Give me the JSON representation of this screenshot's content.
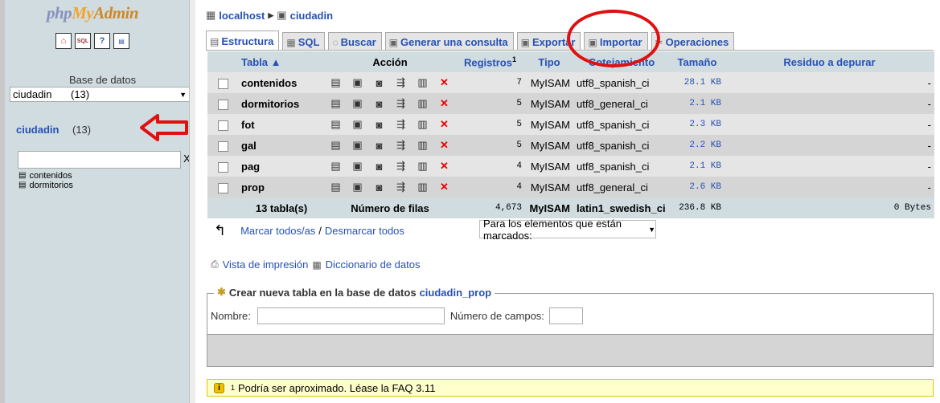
{
  "left": {
    "logo": {
      "php": "php",
      "my": "My",
      "admin": "Admin"
    },
    "db_label": "Base de datos",
    "db_select": {
      "value": "ciudadin",
      "count": "(13)"
    },
    "current_db": {
      "name": "ciudadin",
      "count": "(13)"
    },
    "filter_clear": "X",
    "tables": [
      "contenidos",
      "dormitorios"
    ]
  },
  "breadcrumb": {
    "server": "localhost",
    "db": "ciudadin"
  },
  "tabs": [
    {
      "label": "Estructura",
      "icon": "structure-icon"
    },
    {
      "label": "SQL",
      "icon": "sql-icon"
    },
    {
      "label": "Buscar",
      "icon": "search-icon"
    },
    {
      "label": "Generar una consulta",
      "icon": "query-icon"
    },
    {
      "label": "Exportar",
      "icon": "export-icon"
    },
    {
      "label": "Importar",
      "icon": "import-icon"
    },
    {
      "label": "Operaciones",
      "icon": "operations-icon"
    }
  ],
  "table": {
    "headers": {
      "tabla": "Tabla ▲",
      "accion": "Acción",
      "registros": "Registros",
      "registros_sup": "1",
      "tipo": "Tipo",
      "cotejamiento": "Cotejamiento",
      "tamano": "Tamaño",
      "residuo": "Residuo a depurar"
    },
    "rows": [
      {
        "name": "contenidos",
        "records": "7",
        "type": "MyISAM",
        "collation": "utf8_spanish_ci",
        "size": "28.1 KB",
        "overhead": "-"
      },
      {
        "name": "dormitorios",
        "records": "5",
        "type": "MyISAM",
        "collation": "utf8_general_ci",
        "size": "2.1 KB",
        "overhead": "-"
      },
      {
        "name": "fot",
        "records": "5",
        "type": "MyISAM",
        "collation": "utf8_spanish_ci",
        "size": "2.3 KB",
        "overhead": "-"
      },
      {
        "name": "gal",
        "records": "5",
        "type": "MyISAM",
        "collation": "utf8_spanish_ci",
        "size": "2.2 KB",
        "overhead": "-"
      },
      {
        "name": "pag",
        "records": "4",
        "type": "MyISAM",
        "collation": "utf8_spanish_ci",
        "size": "2.1 KB",
        "overhead": "-"
      },
      {
        "name": "prop",
        "records": "4",
        "type": "MyISAM",
        "collation": "utf8_general_ci",
        "size": "2.6 KB",
        "overhead": "-"
      }
    ],
    "footer": {
      "tables": "13 tabla(s)",
      "rows_label": "Número de filas",
      "records": "4,673",
      "type": "MyISAM",
      "collation": "latin1_swedish_ci",
      "size": "236.8 KB",
      "overhead": "0 Bytes"
    }
  },
  "bulk": {
    "check_all": "Marcar todos/as",
    "separator": "/",
    "uncheck_all": "Desmarcar todos",
    "with_selected": "Para los elementos que están marcados:"
  },
  "links": {
    "print_view": "Vista de impresión",
    "data_dict": "Diccionario de datos"
  },
  "create": {
    "legend": "Crear nueva tabla en la base de datos",
    "db": "ciudadin_prop",
    "name_label": "Nombre:",
    "fields_label": "Número de campos:"
  },
  "notice": {
    "sup": "1",
    "text": "Podría ser aproximado. Léase la FAQ 3.11"
  },
  "colors": {
    "link": "#2651b4",
    "header_bg": "#d0dce0",
    "annotation_red": "#e01010"
  }
}
